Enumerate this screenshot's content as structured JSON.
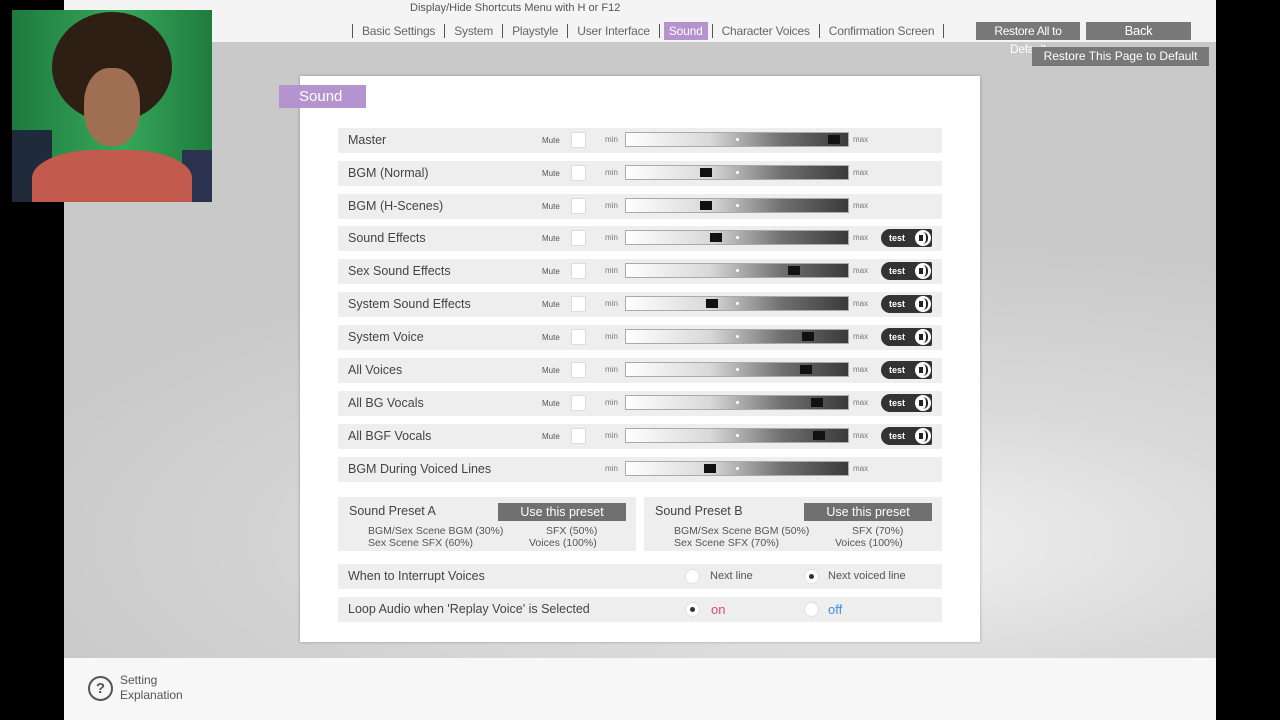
{
  "header": {
    "hint": "Display/Hide Shortcuts Menu with H or F12",
    "tabs": [
      {
        "label": "Basic Settings",
        "active": false
      },
      {
        "label": "System",
        "active": false
      },
      {
        "label": "Playstyle",
        "active": false
      },
      {
        "label": "User Interface",
        "active": false
      },
      {
        "label": "Sound",
        "active": true
      },
      {
        "label": "Character Voices",
        "active": false
      },
      {
        "label": "Confirmation Screen",
        "active": false
      }
    ],
    "restore_all": "Restore All to Default",
    "back": "Back",
    "restore_page": "Restore This Page to Default"
  },
  "panel": {
    "title": "Sound",
    "mute_label": "Mute",
    "min_label": "min",
    "max_label": "max",
    "test_label": "test",
    "rows": [
      {
        "label": "Master",
        "mute": true,
        "test": false,
        "level": 0.96
      },
      {
        "label": "BGM (Normal)",
        "mute": true,
        "test": false,
        "level": 0.35
      },
      {
        "label": "BGM (H-Scenes)",
        "mute": true,
        "test": false,
        "level": 0.35
      },
      {
        "label": "Sound Effects",
        "mute": true,
        "test": true,
        "level": 0.4
      },
      {
        "label": "Sex Sound Effects",
        "mute": true,
        "test": true,
        "level": 0.77
      },
      {
        "label": "System Sound Effects",
        "mute": true,
        "test": true,
        "level": 0.38
      },
      {
        "label": "System Voice",
        "mute": true,
        "test": true,
        "level": 0.84
      },
      {
        "label": "All Voices",
        "mute": true,
        "test": true,
        "level": 0.83
      },
      {
        "label": "All BG Vocals",
        "mute": true,
        "test": true,
        "level": 0.88
      },
      {
        "label": "All BGF Vocals",
        "mute": true,
        "test": true,
        "level": 0.89
      },
      {
        "label": "BGM During Voiced Lines",
        "mute": false,
        "test": false,
        "level": 0.37
      }
    ],
    "presets": [
      {
        "title": "Sound Preset A",
        "button": "Use this preset",
        "line1": "BGM/Sex Scene BGM (30%)",
        "line2": "Sex Scene SFX (60%)",
        "line3": "SFX (50%)",
        "line4": "Voices (100%)"
      },
      {
        "title": "Sound Preset B",
        "button": "Use this preset",
        "line1": "BGM/Sex Scene BGM (50%)",
        "line2": "Sex Scene SFX (70%)",
        "line3": "SFX (70%)",
        "line4": "Voices (100%)"
      }
    ],
    "interrupt": {
      "label": "When to Interrupt Voices",
      "options": [
        {
          "label": "Next line",
          "selected": false
        },
        {
          "label": "Next voiced line",
          "selected": true
        }
      ]
    },
    "loop": {
      "label": "Loop Audio when 'Replay Voice' is Selected",
      "options": [
        {
          "label": "on",
          "selected": true,
          "color": "#e0457b"
        },
        {
          "label": "off",
          "selected": false,
          "color": "#3a8ee6"
        }
      ]
    }
  },
  "footer": {
    "help_icon": "question-icon",
    "help_label": "Setting Explanation"
  }
}
